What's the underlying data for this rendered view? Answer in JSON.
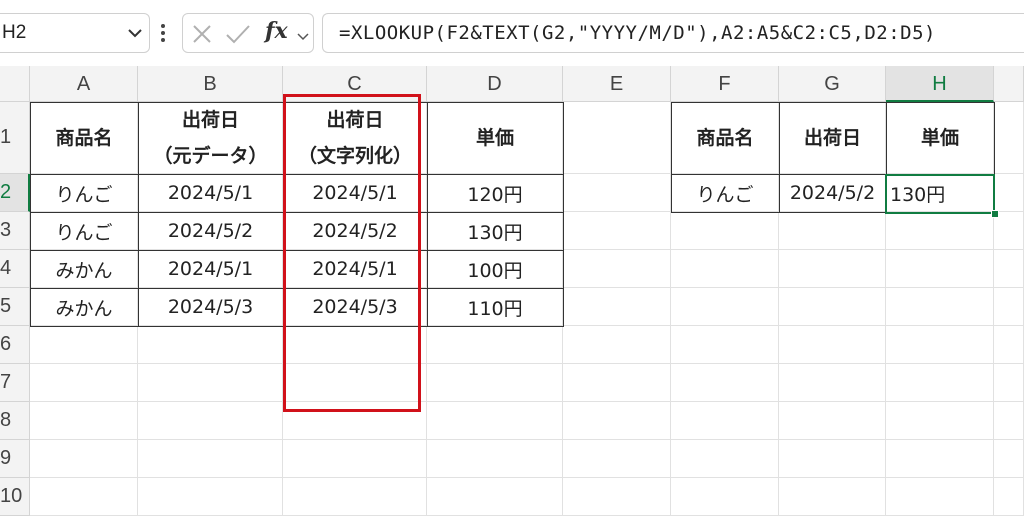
{
  "name_box": {
    "value": "H2"
  },
  "formula": {
    "text": "=XLOOKUP(F2&TEXT(G2,\"YYYY/M/D\"),A2:A5&C2:C5,D2:D5)"
  },
  "columns": [
    "A",
    "B",
    "C",
    "D",
    "E",
    "F",
    "G",
    "H"
  ],
  "rows": [
    "1",
    "2",
    "3",
    "4",
    "5",
    "6",
    "7",
    "8",
    "9",
    "10"
  ],
  "headers": {
    "a": "商品名",
    "b_line1": "出荷日",
    "b_line2": "（元データ）",
    "c_line1": "出荷日",
    "c_line2": "（文字列化）",
    "d": "単価",
    "f": "商品名",
    "g": "出荷日",
    "h": "単価"
  },
  "table": [
    {
      "product": "りんご",
      "date": "2024/5/1",
      "date_text": "2024/5/1",
      "price": "120円"
    },
    {
      "product": "りんご",
      "date": "2024/5/2",
      "date_text": "2024/5/2",
      "price": "130円"
    },
    {
      "product": "みかん",
      "date": "2024/5/1",
      "date_text": "2024/5/1",
      "price": "100円"
    },
    {
      "product": "みかん",
      "date": "2024/5/3",
      "date_text": "2024/5/3",
      "price": "110円"
    }
  ],
  "lookup": {
    "product": "りんご",
    "date": "2024/5/2",
    "result": "130円"
  },
  "colors": {
    "accent": "#107c41",
    "highlight": "#d1111a"
  }
}
